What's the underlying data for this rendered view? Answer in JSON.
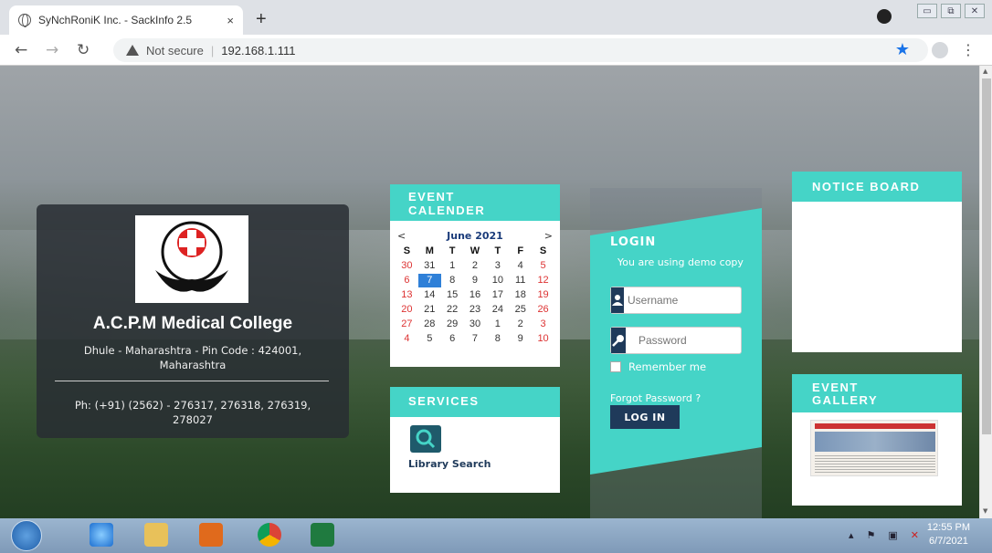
{
  "browser": {
    "tab_title": "SyNchRoniK Inc. - SackInfo 2.5",
    "tab_close": "×",
    "new_tab": "+",
    "not_secure": "Not secure",
    "url": "192.168.1.111"
  },
  "college": {
    "name": "A.C.P.M Medical College",
    "address": "Dhule - Maharashtra - Pin Code : 424001, Maharashtra",
    "phone": "Ph: (+91) (2562) - 276317, 276318, 276319, 278027"
  },
  "event_calendar": {
    "title_line1": "EVENT",
    "title_line2": "CALENDER",
    "prev": "<",
    "month": "June 2021",
    "next": ">",
    "weekdays": [
      "S",
      "M",
      "T",
      "W",
      "T",
      "F",
      "S"
    ],
    "weeks": [
      [
        "30",
        "31",
        "1",
        "2",
        "3",
        "4",
        "5"
      ],
      [
        "6",
        "7",
        "8",
        "9",
        "10",
        "11",
        "12"
      ],
      [
        "13",
        "14",
        "15",
        "16",
        "17",
        "18",
        "19"
      ],
      [
        "20",
        "21",
        "22",
        "23",
        "24",
        "25",
        "26"
      ],
      [
        "27",
        "28",
        "29",
        "30",
        "1",
        "2",
        "3"
      ],
      [
        "4",
        "5",
        "6",
        "7",
        "8",
        "9",
        "10"
      ]
    ],
    "today": "7"
  },
  "services": {
    "title": "SERVICES",
    "items": [
      {
        "label": "Library Search",
        "icon": "library-search-icon"
      }
    ]
  },
  "login": {
    "title": "LOGIN",
    "demo_note": "You are using demo copy",
    "username_placeholder": "Username",
    "password_placeholder": "Password",
    "remember": "Remember me",
    "forgot": "Forgot Password ?",
    "button": "LOG IN"
  },
  "notice_board": {
    "title": "NOTICE BOARD"
  },
  "event_gallery": {
    "title_line1": "EVENT",
    "title_line2": "GALLERY"
  },
  "taskbar": {
    "time": "12:55 PM",
    "date": "6/7/2021"
  },
  "colors": {
    "accent": "#45d4c7",
    "navy": "#1f3a5a",
    "today": "#2f80d8",
    "weekend": "#dd3333"
  }
}
